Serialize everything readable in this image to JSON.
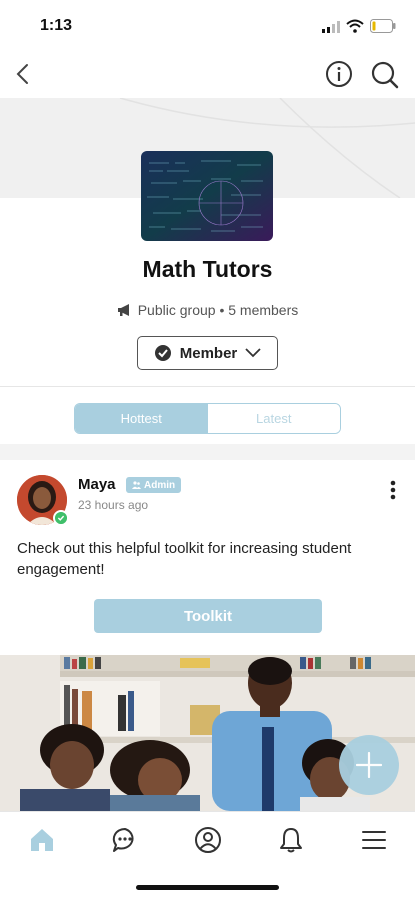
{
  "status_bar": {
    "time": "1:13"
  },
  "group": {
    "name": "Math Tutors",
    "privacy": "Public group",
    "separator": "•",
    "members": "5 members",
    "membership_label": "Member"
  },
  "tabs": [
    {
      "label": "Hottest",
      "active": true
    },
    {
      "label": "Latest",
      "active": false
    }
  ],
  "post": {
    "author": "Maya",
    "role_badge": "Admin",
    "time_ago": "23 hours ago",
    "text": "Check out this helpful toolkit for increasing student engagement!",
    "button_label": "Toolkit"
  },
  "bottom_nav": [
    {
      "icon": "home-icon",
      "active": true
    },
    {
      "icon": "chat-icon",
      "active": false
    },
    {
      "icon": "profile-icon",
      "active": false
    },
    {
      "icon": "bell-icon",
      "active": false
    },
    {
      "icon": "menu-icon",
      "active": false
    }
  ],
  "colors": {
    "accent": "#a9cfdf",
    "online_badge": "#3fbf6a",
    "avatar_bg": "#c4492e"
  }
}
